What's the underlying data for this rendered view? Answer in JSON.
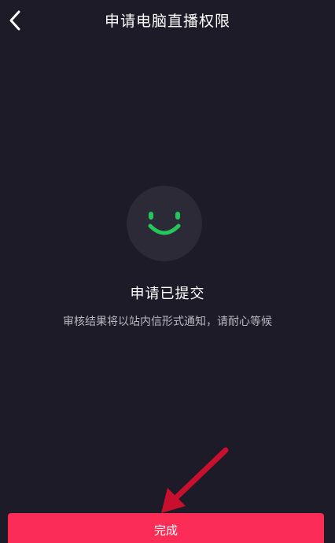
{
  "header": {
    "title": "申请电脑直播权限",
    "back_icon": "chevron-left-icon"
  },
  "status": {
    "icon": "smiley-face-icon",
    "icon_color": "#25c75d",
    "title": "申请已提交",
    "description": "审核结果将以站内信形式通知，请耐心等候"
  },
  "footer": {
    "done_label": "完成",
    "button_color": "#fb2c55"
  },
  "annotation": {
    "arrow_color": "#c8102e"
  }
}
